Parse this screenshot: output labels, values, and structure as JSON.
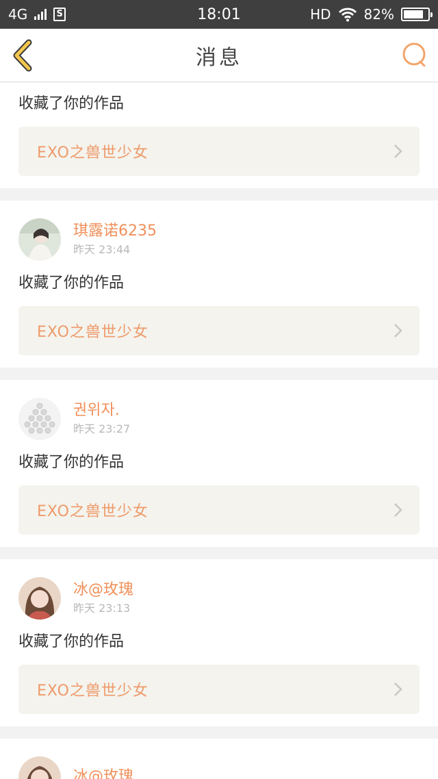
{
  "status": {
    "network": "4G",
    "sim": "S",
    "time": "18:01",
    "hd": "HD",
    "battery_text": "82%",
    "battery_level": 0.82
  },
  "header": {
    "title": "消息",
    "accent": "#f0b44a"
  },
  "messages": [
    {
      "user": "",
      "time": "",
      "action": "收藏了你的作品",
      "work": "EXO之兽世少女"
    },
    {
      "user": "琪露诺6235",
      "time": "昨天 23:44",
      "action": "收藏了你的作品",
      "work": "EXO之兽世少女"
    },
    {
      "user": "권위자.",
      "time": "昨天 23:27",
      "action": "收藏了你的作品",
      "work": "EXO之兽世少女"
    },
    {
      "user": "冰@玫瑰",
      "time": "昨天 23:13",
      "action": "收藏了你的作品",
      "work": "EXO之兽世少女"
    },
    {
      "user": "冰@玫瑰",
      "time": "",
      "action": "",
      "work": ""
    }
  ]
}
